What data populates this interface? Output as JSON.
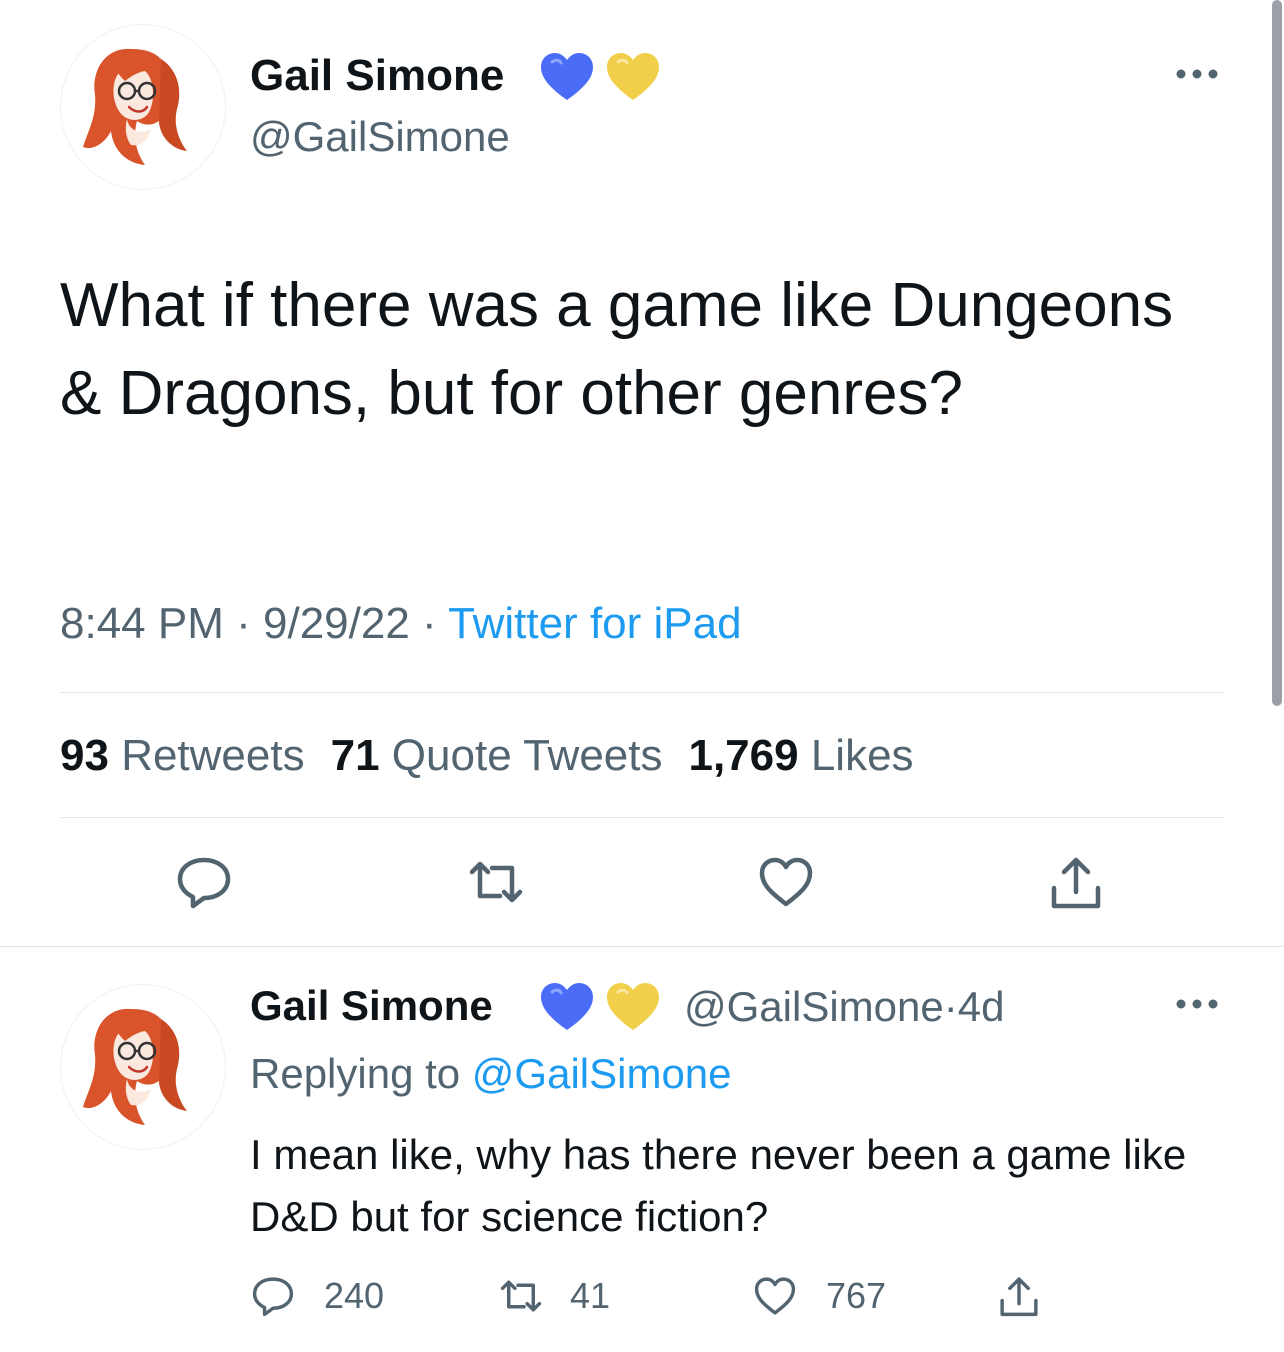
{
  "main_tweet": {
    "display_name": "Gail Simone",
    "badges": [
      "blue-heart-icon",
      "yellow-heart-icon"
    ],
    "handle": "@GailSimone",
    "text": "What if there was a game like Dungeons & Dragons, but for other genres?",
    "time": "8:44 PM",
    "separator": "·",
    "date": "9/29/22",
    "source": "Twitter for iPad",
    "stats": {
      "retweets_count": "93",
      "retweets_label": "Retweets",
      "quotes_count": "71",
      "quotes_label": "Quote Tweets",
      "likes_count": "1,769",
      "likes_label": "Likes"
    },
    "actions": [
      "reply-icon",
      "retweet-icon",
      "like-icon",
      "share-icon"
    ]
  },
  "reply_tweet": {
    "display_name": "Gail Simone",
    "badges": [
      "blue-heart-icon",
      "yellow-heart-icon"
    ],
    "handle": "@GailSimone",
    "separator": "·",
    "age": "4d",
    "replying_label": "Replying to",
    "replying_to": "@GailSimone",
    "text": "I mean like, why has there never been a game like D&D but for science fiction?",
    "actions": {
      "replies": "240",
      "retweets": "41",
      "likes": "767"
    }
  },
  "colors": {
    "text": "#0f1419",
    "secondary": "#536471",
    "link": "#1d9bf0",
    "divider": "#e1e5e8",
    "blue_heart": "#4a6cf7",
    "yellow_heart": "#f2cf4a",
    "hair": "#d9542b"
  }
}
